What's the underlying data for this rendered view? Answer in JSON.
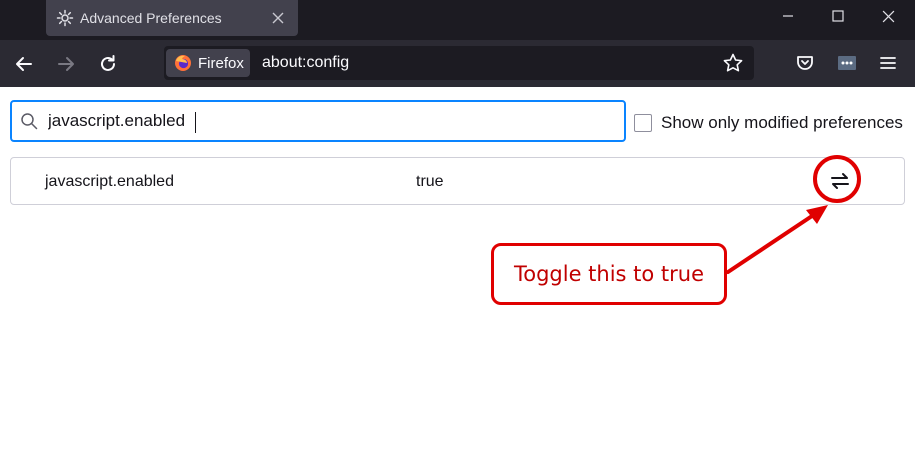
{
  "window": {
    "tab_title": "Advanced Preferences",
    "tab_icon": "gear-icon"
  },
  "navbar": {
    "identity_label": "Firefox",
    "url": "about:config"
  },
  "search": {
    "value": "javascript.enabled",
    "placeholder": ""
  },
  "filters": {
    "show_modified_label": "Show only modified preferences",
    "show_modified_checked": false
  },
  "preferences": [
    {
      "name": "javascript.enabled",
      "value": "true",
      "action": "toggle-icon"
    }
  ],
  "annotation": {
    "callout_text": "Toggle this to true",
    "color": "#e00000"
  },
  "colors": {
    "titlebar": "#1c1b22",
    "navbar": "#2b2a33",
    "accent": "#0a84ff"
  }
}
